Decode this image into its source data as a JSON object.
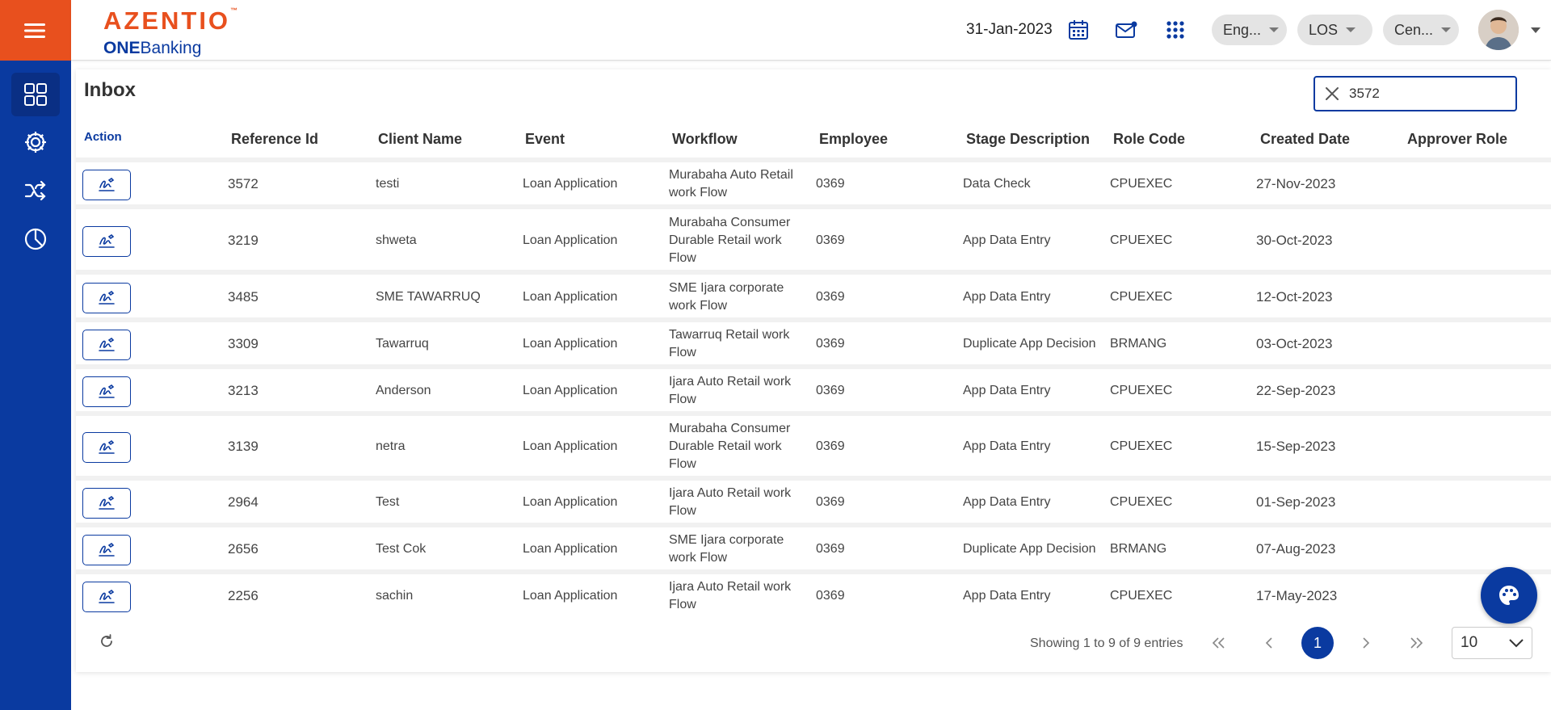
{
  "app": {
    "brand": "AZENTIO",
    "brand_mark": "™",
    "product_bold": "ONE",
    "product_rest": "Banking"
  },
  "header": {
    "date": "31-Jan-2023",
    "language": "Eng...",
    "module": "LOS",
    "branch": "Cen...",
    "icons": [
      "calendar-icon",
      "mail-icon",
      "apps-grid-icon"
    ]
  },
  "sidebar": {
    "items": [
      {
        "name": "dashboard-icon",
        "active": true
      },
      {
        "name": "settings-icon",
        "active": false
      },
      {
        "name": "shuffle-icon",
        "active": false
      },
      {
        "name": "pie-chart-icon",
        "active": false
      }
    ]
  },
  "page": {
    "title": "Inbox",
    "search_value": "3572"
  },
  "table": {
    "columns": [
      "Action",
      "Reference Id",
      "Client Name",
      "Event",
      "Workflow",
      "Employee",
      "Stage Description",
      "Role Code",
      "Created Date",
      "Approver Role"
    ],
    "rows": [
      {
        "ref": "3572",
        "client": "testi",
        "event": "Loan Application",
        "workflow": "Murabaha Auto Retail work Flow",
        "employee": "0369",
        "stage": "Data Check",
        "role": "CPUEXEC",
        "created": "27-Nov-2023",
        "approver": ""
      },
      {
        "ref": "3219",
        "client": "shweta",
        "event": "Loan Application",
        "workflow": "Murabaha Consumer Durable Retail work Flow",
        "employee": "0369",
        "stage": "App Data Entry",
        "role": "CPUEXEC",
        "created": "30-Oct-2023",
        "approver": ""
      },
      {
        "ref": "3485",
        "client": "SME TAWARRUQ",
        "event": "Loan Application",
        "workflow": "SME Ijara corporate work Flow",
        "employee": "0369",
        "stage": "App Data Entry",
        "role": "CPUEXEC",
        "created": "12-Oct-2023",
        "approver": ""
      },
      {
        "ref": "3309",
        "client": "Tawarruq",
        "event": "Loan Application",
        "workflow": "Tawarruq Retail work Flow",
        "employee": "0369",
        "stage": "Duplicate App Decision",
        "role": "BRMANG",
        "created": "03-Oct-2023",
        "approver": ""
      },
      {
        "ref": "3213",
        "client": "Anderson",
        "event": "Loan Application",
        "workflow": "Ijara Auto Retail work Flow",
        "employee": "0369",
        "stage": "App Data Entry",
        "role": "CPUEXEC",
        "created": "22-Sep-2023",
        "approver": ""
      },
      {
        "ref": "3139",
        "client": "netra",
        "event": "Loan Application",
        "workflow": "Murabaha Consumer Durable Retail work Flow",
        "employee": "0369",
        "stage": "App Data Entry",
        "role": "CPUEXEC",
        "created": "15-Sep-2023",
        "approver": ""
      },
      {
        "ref": "2964",
        "client": "Test",
        "event": "Loan Application",
        "workflow": "Ijara Auto Retail work Flow",
        "employee": "0369",
        "stage": "App Data Entry",
        "role": "CPUEXEC",
        "created": "01-Sep-2023",
        "approver": ""
      },
      {
        "ref": "2656",
        "client": "Test Cok",
        "event": "Loan Application",
        "workflow": "SME Ijara corporate work Flow",
        "employee": "0369",
        "stage": "Duplicate App Decision",
        "role": "BRMANG",
        "created": "07-Aug-2023",
        "approver": ""
      },
      {
        "ref": "2256",
        "client": "sachin",
        "event": "Loan Application",
        "workflow": "Ijara Auto Retail work Flow",
        "employee": "0369",
        "stage": "App Data Entry",
        "role": "CPUEXEC",
        "created": "17-May-2023",
        "approver": ""
      }
    ]
  },
  "pagination": {
    "summary": "Showing 1 to 9 of 9 entries",
    "current_page": "1",
    "page_size": "10"
  },
  "colors": {
    "primary": "#0a3aa0",
    "accent": "#e8501e"
  }
}
